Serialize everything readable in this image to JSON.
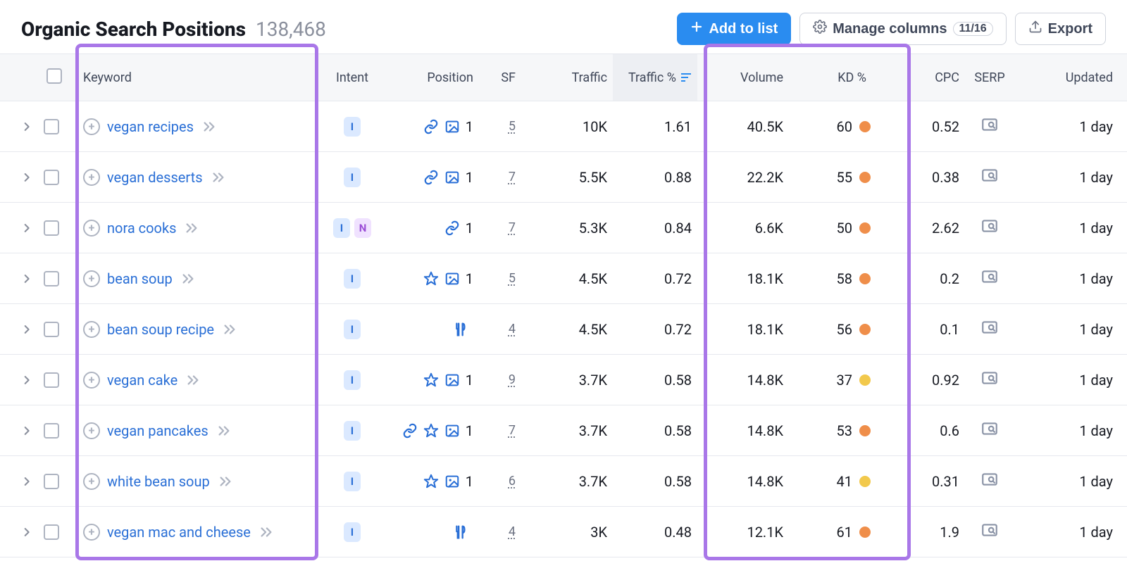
{
  "header": {
    "title": "Organic Search Positions",
    "count": "138,468",
    "add_to_list": "Add to list",
    "manage_columns": "Manage columns",
    "columns_badge": "11/16",
    "export": "Export"
  },
  "columns": {
    "keyword": "Keyword",
    "intent": "Intent",
    "position": "Position",
    "sf": "SF",
    "traffic": "Traffic",
    "traffic_pct": "Traffic %",
    "volume": "Volume",
    "kd": "KD %",
    "cpc": "CPC",
    "serp": "SERP",
    "updated": "Updated"
  },
  "kd_colors": {
    "orange": "#ef8e4a",
    "yellow": "#f2c94c"
  },
  "rows": [
    {
      "keyword": "vegan recipes",
      "intents": [
        "I"
      ],
      "pos_icons": [
        "link",
        "image"
      ],
      "position": "1",
      "sf": "5",
      "traffic": "10K",
      "traffic_pct": "1.61",
      "volume": "40.5K",
      "kd": "60",
      "kd_color": "orange",
      "cpc": "0.52",
      "updated": "1 day"
    },
    {
      "keyword": "vegan desserts",
      "intents": [
        "I"
      ],
      "pos_icons": [
        "link",
        "image"
      ],
      "position": "1",
      "sf": "7",
      "traffic": "5.5K",
      "traffic_pct": "0.88",
      "volume": "22.2K",
      "kd": "55",
      "kd_color": "orange",
      "cpc": "0.38",
      "updated": "1 day"
    },
    {
      "keyword": "nora cooks",
      "intents": [
        "I",
        "N"
      ],
      "pos_icons": [
        "link"
      ],
      "position": "1",
      "sf": "7",
      "traffic": "5.3K",
      "traffic_pct": "0.84",
      "volume": "6.6K",
      "kd": "50",
      "kd_color": "orange",
      "cpc": "2.62",
      "updated": "1 day"
    },
    {
      "keyword": "bean soup",
      "intents": [
        "I"
      ],
      "pos_icons": [
        "star",
        "image"
      ],
      "position": "1",
      "sf": "5",
      "traffic": "4.5K",
      "traffic_pct": "0.72",
      "volume": "18.1K",
      "kd": "58",
      "kd_color": "orange",
      "cpc": "0.2",
      "updated": "1 day"
    },
    {
      "keyword": "bean soup recipe",
      "intents": [
        "I"
      ],
      "pos_icons": [
        "food"
      ],
      "position": "",
      "sf": "4",
      "traffic": "4.5K",
      "traffic_pct": "0.72",
      "volume": "18.1K",
      "kd": "56",
      "kd_color": "orange",
      "cpc": "0.1",
      "updated": "1 day"
    },
    {
      "keyword": "vegan cake",
      "intents": [
        "I"
      ],
      "pos_icons": [
        "star",
        "image"
      ],
      "position": "1",
      "sf": "9",
      "traffic": "3.7K",
      "traffic_pct": "0.58",
      "volume": "14.8K",
      "kd": "37",
      "kd_color": "yellow",
      "cpc": "0.92",
      "updated": "1 day"
    },
    {
      "keyword": "vegan pancakes",
      "intents": [
        "I"
      ],
      "pos_icons": [
        "link",
        "star",
        "image"
      ],
      "position": "1",
      "sf": "7",
      "traffic": "3.7K",
      "traffic_pct": "0.58",
      "volume": "14.8K",
      "kd": "53",
      "kd_color": "orange",
      "cpc": "0.6",
      "updated": "1 day"
    },
    {
      "keyword": "white bean soup",
      "intents": [
        "I"
      ],
      "pos_icons": [
        "star",
        "image"
      ],
      "position": "1",
      "sf": "6",
      "traffic": "3.7K",
      "traffic_pct": "0.58",
      "volume": "14.8K",
      "kd": "41",
      "kd_color": "yellow",
      "cpc": "0.31",
      "updated": "1 day"
    },
    {
      "keyword": "vegan mac and cheese",
      "intents": [
        "I"
      ],
      "pos_icons": [
        "food"
      ],
      "position": "",
      "sf": "4",
      "traffic": "3K",
      "traffic_pct": "0.48",
      "volume": "12.1K",
      "kd": "61",
      "kd_color": "orange",
      "cpc": "1.9",
      "updated": "1 day"
    }
  ]
}
